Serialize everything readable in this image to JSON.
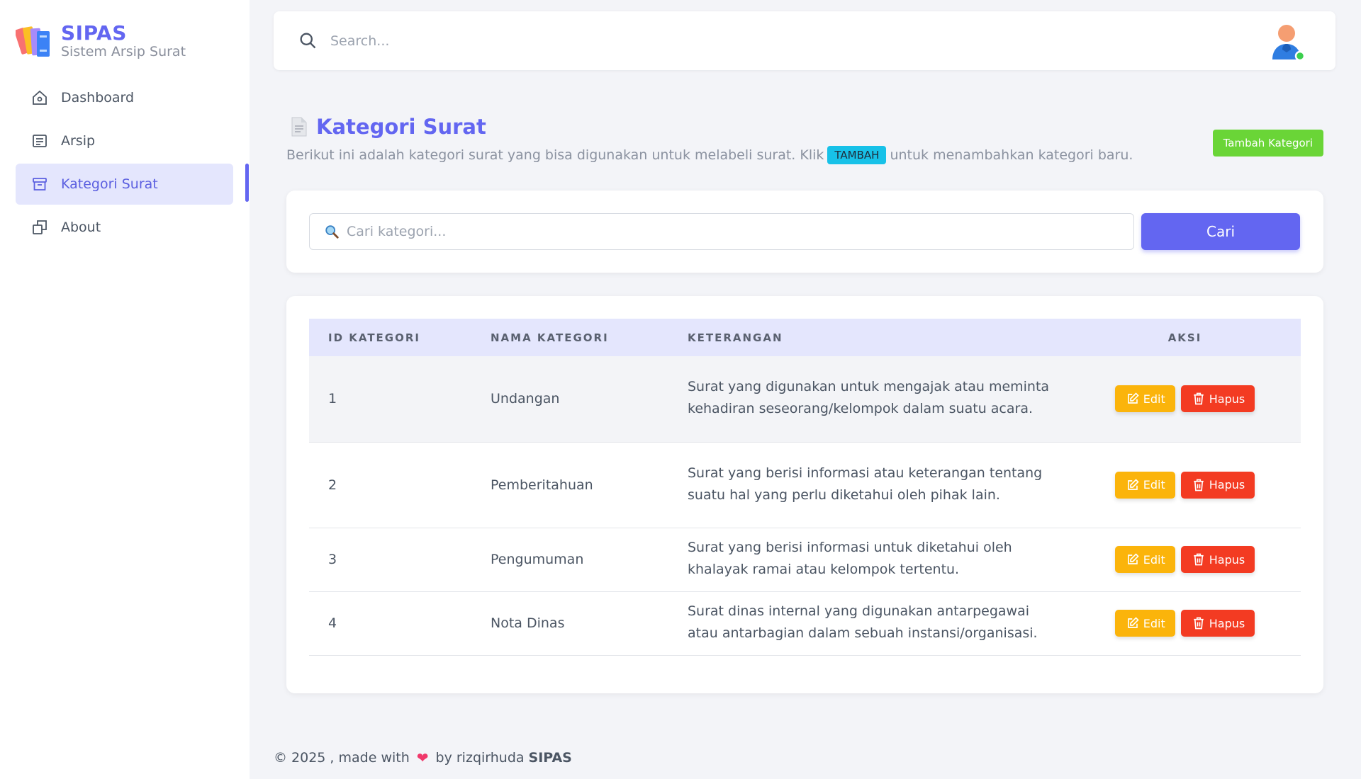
{
  "brand": {
    "name": "SIPAS",
    "subtitle": "Sistem Arsip Surat"
  },
  "sidebar": {
    "items": [
      {
        "label": "Dashboard",
        "icon": "home-icon",
        "active": false
      },
      {
        "label": "Arsip",
        "icon": "document-list-icon",
        "active": false
      },
      {
        "label": "Kategori Surat",
        "icon": "archive-box-icon",
        "active": true
      },
      {
        "label": "About",
        "icon": "squares-icon",
        "active": false
      }
    ]
  },
  "topbar": {
    "search_placeholder": "Search..."
  },
  "page": {
    "title": "Kategori Surat",
    "desc_before": "Berikut ini adalah kategori surat yang bisa digunakan untuk melabeli surat. Klik",
    "badge": "TAMBAH",
    "desc_after": "untuk menambahkan kategori baru.",
    "add_button": "Tambah Kategori"
  },
  "category_search": {
    "placeholder": "Cari kategori...",
    "button": "Cari"
  },
  "table": {
    "headers": [
      "ID KATEGORI",
      "NAMA KATEGORI",
      "KETERANGAN",
      "AKSI"
    ],
    "rows": [
      {
        "id": "1",
        "name": "Undangan",
        "desc": "Surat yang digunakan untuk mengajak atau meminta kehadiran seseorang/kelompok dalam suatu acara."
      },
      {
        "id": "2",
        "name": "Pemberitahuan",
        "desc": "Surat yang berisi informasi atau keterangan tentang suatu hal yang perlu diketahui oleh pihak lain."
      },
      {
        "id": "3",
        "name": "Pengumuman",
        "desc": "Surat yang berisi informasi untuk diketahui oleh khalayak ramai atau kelompok tertentu."
      },
      {
        "id": "4",
        "name": "Nota Dinas",
        "desc": "Surat dinas internal yang digunakan antarpegawai atau antarbagian dalam sebuah instansi/organisasi."
      }
    ],
    "edit_label": "Edit",
    "delete_label": "Hapus"
  },
  "footer": {
    "prefix": "© 2025 , made with",
    "by": "by rizqirhuda",
    "brand": "SIPAS"
  },
  "colors": {
    "primary": "#6366f1",
    "success": "#6ad537",
    "info": "#17c1e8",
    "warning": "#fbb40b",
    "danger": "#f33b22"
  }
}
